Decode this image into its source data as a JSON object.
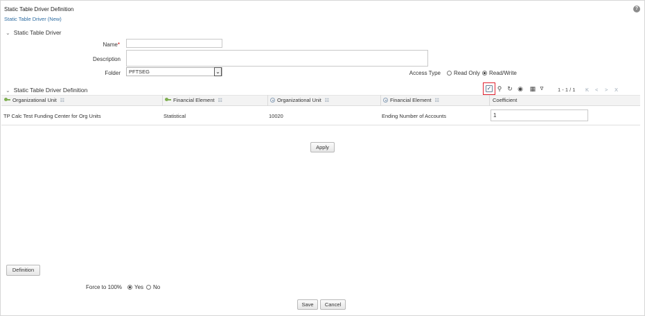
{
  "page": {
    "title": "Static Table Driver Definition",
    "breadcrumb": "Static Table Driver (New)",
    "help_icon": "help-icon",
    "help_glyph": "?"
  },
  "driver_section": {
    "title": "Static Table Driver",
    "name_label": "Name",
    "name_required_mark": "*",
    "name_value": "",
    "description_label": "Description",
    "description_value": "",
    "folder_label": "Folder",
    "folder_value": "PFTSEG",
    "access_type_label": "Access Type",
    "access_options": [
      "Read Only",
      "Read/Write"
    ],
    "access_selected": "Read/Write"
  },
  "definition_section": {
    "title": "Static Table Driver Definition",
    "toolbar": {
      "select_icon": "checkbox-icon",
      "search_icon": "search-icon",
      "refresh_icon": "refresh-icon",
      "view_icon": "view-icon",
      "grid_icon": "grid-icon",
      "sort_icon": "sort-icon",
      "pagination": "1 - 1 / 1",
      "first_page": "K",
      "prev_page": "<",
      "next_page": ">",
      "last_page": "X"
    },
    "columns": [
      {
        "label": "Organizational Unit",
        "icon": "key-icon"
      },
      {
        "label": "Financial Element",
        "icon": "key-icon"
      },
      {
        "label": "Organizational Unit",
        "icon": "org-icon"
      },
      {
        "label": "Financial Element",
        "icon": "org-icon"
      },
      {
        "label": "Coefficient",
        "icon": ""
      }
    ],
    "rows": [
      [
        "TP Calc Test Funding Center for Org Units",
        "Statistical",
        "10020",
        "Ending Number of Accounts",
        "1"
      ]
    ],
    "apply_label": "Apply"
  },
  "footer": {
    "definition_label": "Definition",
    "force_label": "Force to 100%",
    "force_options": [
      "Yes",
      "No"
    ],
    "force_selected": "Yes",
    "save_label": "Save",
    "cancel_label": "Cancel"
  },
  "colors": {
    "accent": "#2d6ca2",
    "highlight": "#e0202e",
    "required": "#cc0000"
  }
}
